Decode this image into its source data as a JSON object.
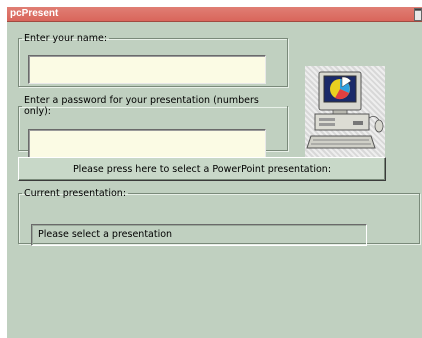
{
  "window": {
    "title": "pcPresent",
    "title_button": "▔"
  },
  "name_group": {
    "legend": "Enter your name:",
    "value": ""
  },
  "password_group": {
    "legend": "Enter a password for your presentation (numbers only):",
    "value": ""
  },
  "select_button": {
    "label": "Please press here to select a PowerPoint presentation:"
  },
  "current_group": {
    "legend": "Current presentation:",
    "status": "Please select a presentation"
  },
  "picture": {
    "icon": "computer-with-pie-chart-icon"
  },
  "colors": {
    "window_bg": "#c0d0c0",
    "titlebar": "#d9665b",
    "input_bg": "#fbfbe4"
  }
}
